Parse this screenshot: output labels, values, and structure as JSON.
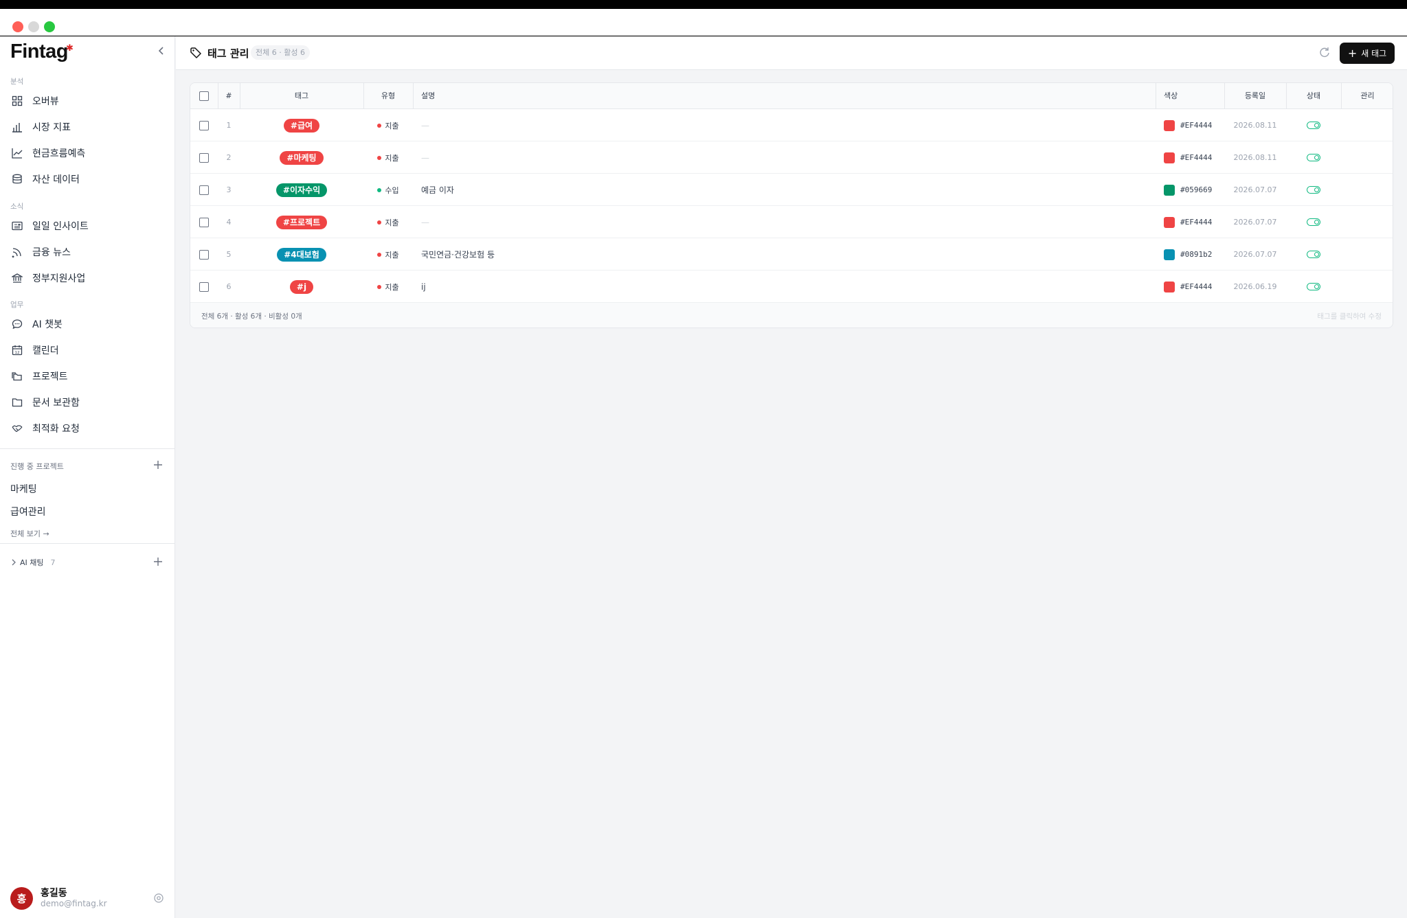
{
  "app": {
    "brand": "Fintag"
  },
  "sidebar": {
    "sections": [
      {
        "label": "분석",
        "items": [
          {
            "label": "오버뷰",
            "icon": "grid-icon"
          },
          {
            "label": "시장 지표",
            "icon": "bar-chart-icon"
          },
          {
            "label": "현금흐름예측",
            "icon": "trend-line-icon"
          },
          {
            "label": "자산 데이터",
            "icon": "database-icon"
          }
        ]
      },
      {
        "label": "소식",
        "items": [
          {
            "label": "일일 인사이트",
            "icon": "newspaper-icon"
          },
          {
            "label": "금융 뉴스",
            "icon": "rss-icon"
          },
          {
            "label": "정부지원사업",
            "icon": "bank-icon"
          }
        ]
      },
      {
        "label": "업무",
        "items": [
          {
            "label": "AI 챗봇",
            "icon": "chat-bubble-icon"
          },
          {
            "label": "캘린더",
            "icon": "calendar-icon"
          },
          {
            "label": "프로젝트",
            "icon": "folders-icon"
          },
          {
            "label": "문서 보관함",
            "icon": "folder-icon"
          },
          {
            "label": "최적화 요청",
            "icon": "handshake-icon"
          }
        ]
      }
    ],
    "projects": {
      "label": "진행 중 프로젝트",
      "items": [
        "마케팅",
        "급여관리"
      ],
      "view_all": "전체 보기 →"
    },
    "ai_chat": {
      "label": "AI 채팅",
      "count": "7"
    },
    "user": {
      "initial": "홍",
      "name": "홍길동",
      "email": "demo@fintag.kr"
    }
  },
  "header": {
    "title": "태그 관리",
    "badge": "전체 6 · 활성 6",
    "new_button": "새 태그"
  },
  "table": {
    "columns": [
      "#",
      "태그",
      "유형",
      "설명",
      "색상",
      "등록일",
      "상태",
      "관리"
    ],
    "rows": [
      {
        "no": "1",
        "tag": "#급여",
        "type": "지출",
        "desc": "—",
        "color": "#EF4444",
        "date": "2026.08.11",
        "active": true
      },
      {
        "no": "2",
        "tag": "#마케팅",
        "type": "지출",
        "desc": "—",
        "color": "#EF4444",
        "date": "2026.08.11",
        "active": true
      },
      {
        "no": "3",
        "tag": "#이자수익",
        "type": "수입",
        "desc": "예금 이자",
        "color": "#059669",
        "date": "2026.07.07",
        "active": true
      },
      {
        "no": "4",
        "tag": "#프로젝트",
        "type": "지출",
        "desc": "—",
        "color": "#EF4444",
        "date": "2026.07.07",
        "active": true
      },
      {
        "no": "5",
        "tag": "#4대보험",
        "type": "지출",
        "desc": "국민연금·건강보험 등",
        "color": "#0891b2",
        "date": "2026.07.07",
        "active": true
      },
      {
        "no": "6",
        "tag": "#j",
        "type": "지출",
        "desc": "ij",
        "color": "#EF4444",
        "date": "2026.06.19",
        "active": true
      }
    ],
    "footer_left": "전체 6개 · 활성 6개 · 비활성 0개",
    "footer_right": "태그를 클릭하여 수정"
  },
  "colors": {
    "expense_dot": "#ef4444",
    "income_dot": "#10b981",
    "toggle_on": "#10b981"
  }
}
